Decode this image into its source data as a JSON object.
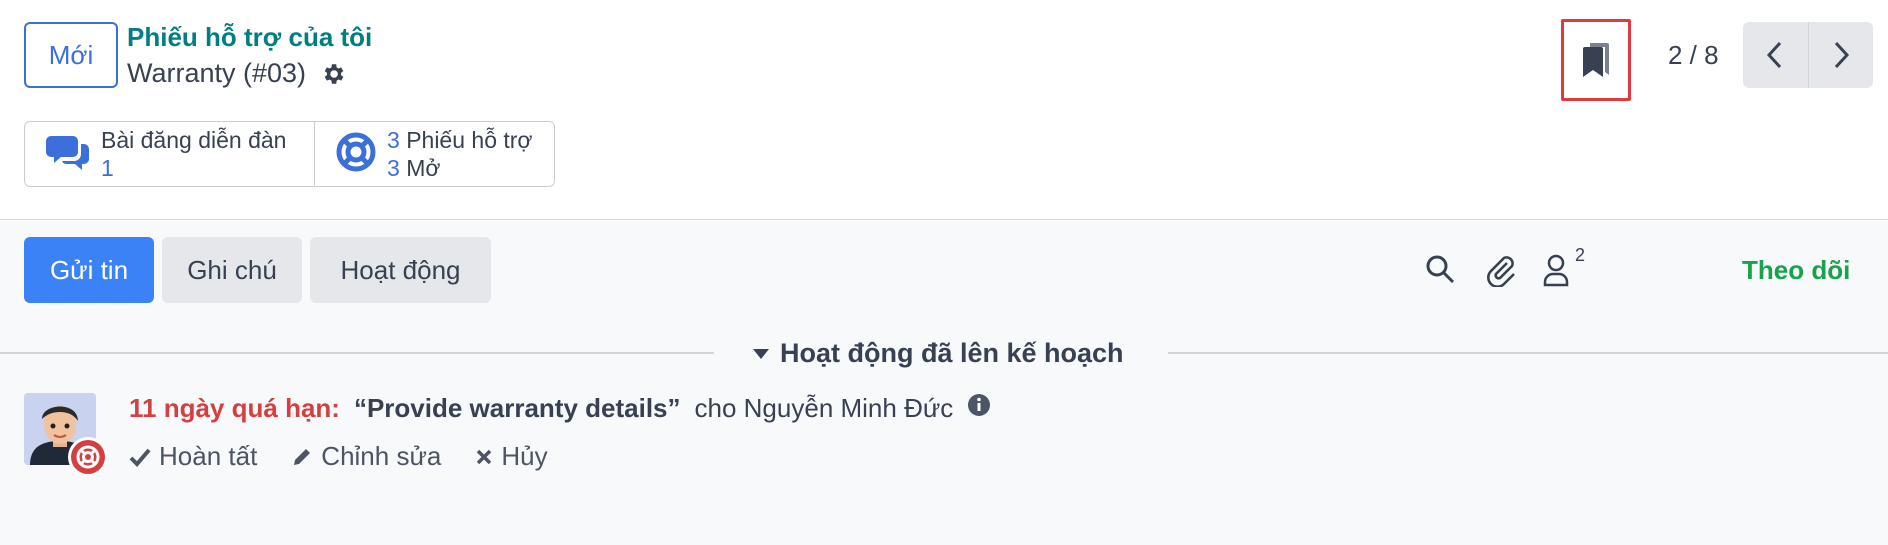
{
  "control_panel": {
    "new_button": "Mới",
    "breadcrumb": "Phiếu hỗ trợ của tôi",
    "record_title": "Warranty (#03)",
    "pager": "2 / 8"
  },
  "smart_buttons": [
    {
      "label": "Bài đăng diễn đàn",
      "count": "1"
    },
    {
      "count_1": "3",
      "label_1": "Phiếu hỗ trợ",
      "count_2": "3",
      "label_2": "Mở"
    }
  ],
  "chatter": {
    "send_message": "Gửi tin",
    "log_note": "Ghi chú",
    "activities": "Hoạt động",
    "followers_count": "2",
    "follow": "Theo dõi",
    "planned_header": "Hoạt động đã lên kế hoạch",
    "activity": {
      "overdue": "11 ngày quá hạn:",
      "summary": "“Provide warranty details”",
      "assignee": "cho Nguyễn Minh Đức",
      "actions": {
        "done": "Hoàn tất",
        "edit": "Chỉnh sửa",
        "cancel": "Hủy"
      }
    }
  },
  "colors": {
    "primary": "#3b82f6",
    "breadcrumb": "#017e84",
    "overdue": "#d63f3f",
    "follow": "#16a34a",
    "highlight_box": "#e0393e"
  }
}
